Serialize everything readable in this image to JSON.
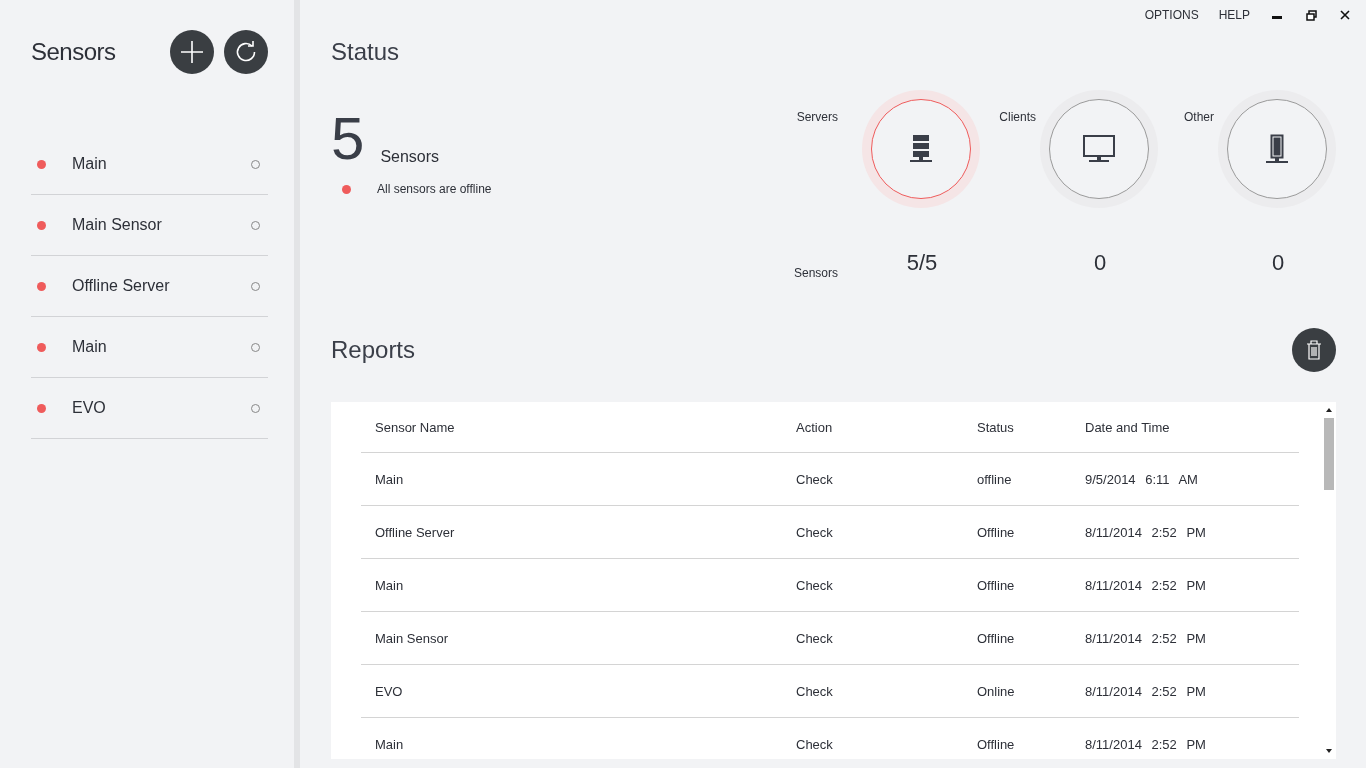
{
  "window": {
    "menu": [
      "OPTIONS",
      "HELP"
    ]
  },
  "sidebar": {
    "title": "Sensors",
    "items": [
      {
        "name": "Main",
        "color": "#ef5b5b"
      },
      {
        "name": "Main Sensor",
        "color": "#ef5b5b"
      },
      {
        "name": "Offline Server",
        "color": "#ef5b5b"
      },
      {
        "name": "Main",
        "color": "#ef5b5b"
      },
      {
        "name": "EVO",
        "color": "#ef5b5b"
      }
    ]
  },
  "status": {
    "title": "Status",
    "count": "5",
    "count_label": "Sensors",
    "message": "All sensors are offline",
    "row_label": "Sensors",
    "devices": [
      {
        "kind": "server",
        "label": "Servers",
        "value": "5/5",
        "selected": true
      },
      {
        "kind": "client",
        "label": "Clients",
        "value": "0",
        "selected": false
      },
      {
        "kind": "other",
        "label": "Other",
        "value": "0",
        "selected": false
      }
    ]
  },
  "reports": {
    "title": "Reports",
    "columns": [
      "Sensor Name",
      "Action",
      "Status",
      "Date and Time"
    ],
    "rows": [
      [
        "Main",
        "Check",
        "offline",
        "9/5/2014 6:11 AM"
      ],
      [
        "Offline Server",
        "Check",
        "Offline",
        "8/11/2014 2:52 PM"
      ],
      [
        "Main",
        "Check",
        "Offline",
        "8/11/2014 2:52 PM"
      ],
      [
        "Main Sensor",
        "Check",
        "Offline",
        "8/11/2014 2:52 PM"
      ],
      [
        "EVO",
        "Check",
        "Online",
        "8/11/2014 2:52 PM"
      ],
      [
        "Main",
        "Check",
        "Offline",
        "8/11/2014 2:52 PM"
      ]
    ]
  }
}
